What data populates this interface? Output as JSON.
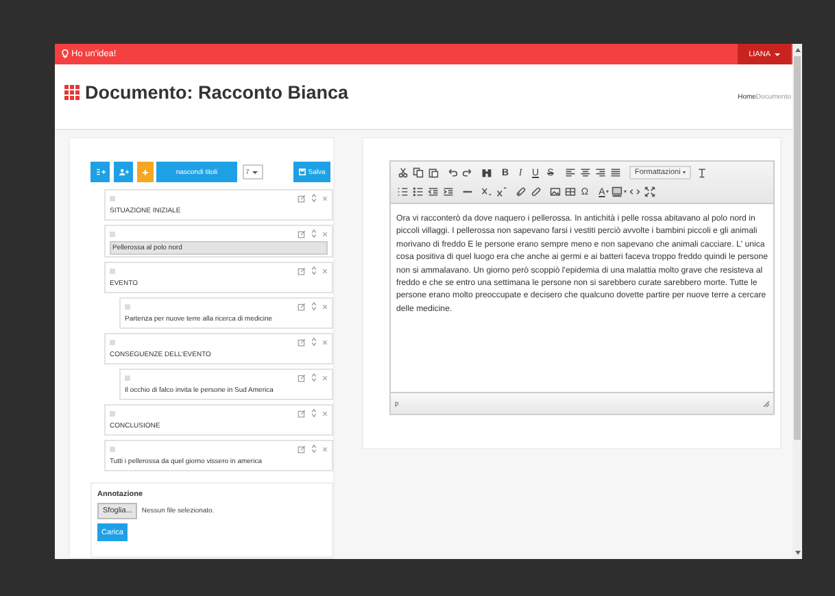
{
  "navbar": {
    "brand": "Ho un'idea!",
    "user_menu": "LIANA"
  },
  "header": {
    "title": "Documento: Racconto Bianca",
    "breadcrumb": [
      "Home",
      "Documento"
    ]
  },
  "block_toolbar": {
    "hide_titles_button": "nascondi titoli",
    "level_select": "7",
    "save_button": "Salva"
  },
  "blocks": [
    {
      "text": "SITUAZIONE INIZIALE",
      "selected": false
    },
    {
      "text": "Pellerossa al polo nord",
      "selected": true
    },
    {
      "text": "EVENTO",
      "selected": false,
      "children": [
        {
          "text": "Partenza per nuove terre alla ricerca di medicine",
          "selected": false
        }
      ]
    },
    {
      "text": "CONSEGUENZE DELL'EVENTO",
      "selected": false,
      "children": [
        {
          "text": "Il occhio di falco invita le persone in Sud America",
          "selected": false
        }
      ]
    },
    {
      "text": "CONCLUSIONE",
      "selected": false
    },
    {
      "text": "Tutti i pellerossa da quel giorno vissero in america",
      "selected": false
    }
  ],
  "editor": {
    "format_buttons": [
      "B",
      "I",
      "U",
      "S"
    ],
    "styles_dropdown": "Formattazioni",
    "special_char_button": "Ω",
    "text_color_button": "A",
    "content": "Ora vi racconterò da dove naquero i pellerossa. In antichità i pelle rossa abitavano al polo nord in piccoli villaggi. I pellerossa non sapevano farsi i vestiti perciò avvolte i bambini piccoli e gli animali morivano di freddo E le persone erano sempre meno e non sapevano che animali cacciare. L' unica cosa positiva di quel luogo era che anche ai germi e ai batteri faceva troppo freddo quindi le persone non si ammalavano. Un giorno però scoppiò l'epidemia di una malattia molto grave che resisteva al freddo e che se entro una settimana le persone non si sarebbero curate sarebbero morte. Tutte le persone erano molto preoccupate e decisero che qualcuno dovette partire per nuove terre a cercare delle medicine.",
    "element_path": "p"
  },
  "annotation": {
    "label": "Annotazione",
    "browse_button": "Sfoglia...",
    "file_status": "Nessun file selezionato.",
    "upload_button": "Carica"
  }
}
